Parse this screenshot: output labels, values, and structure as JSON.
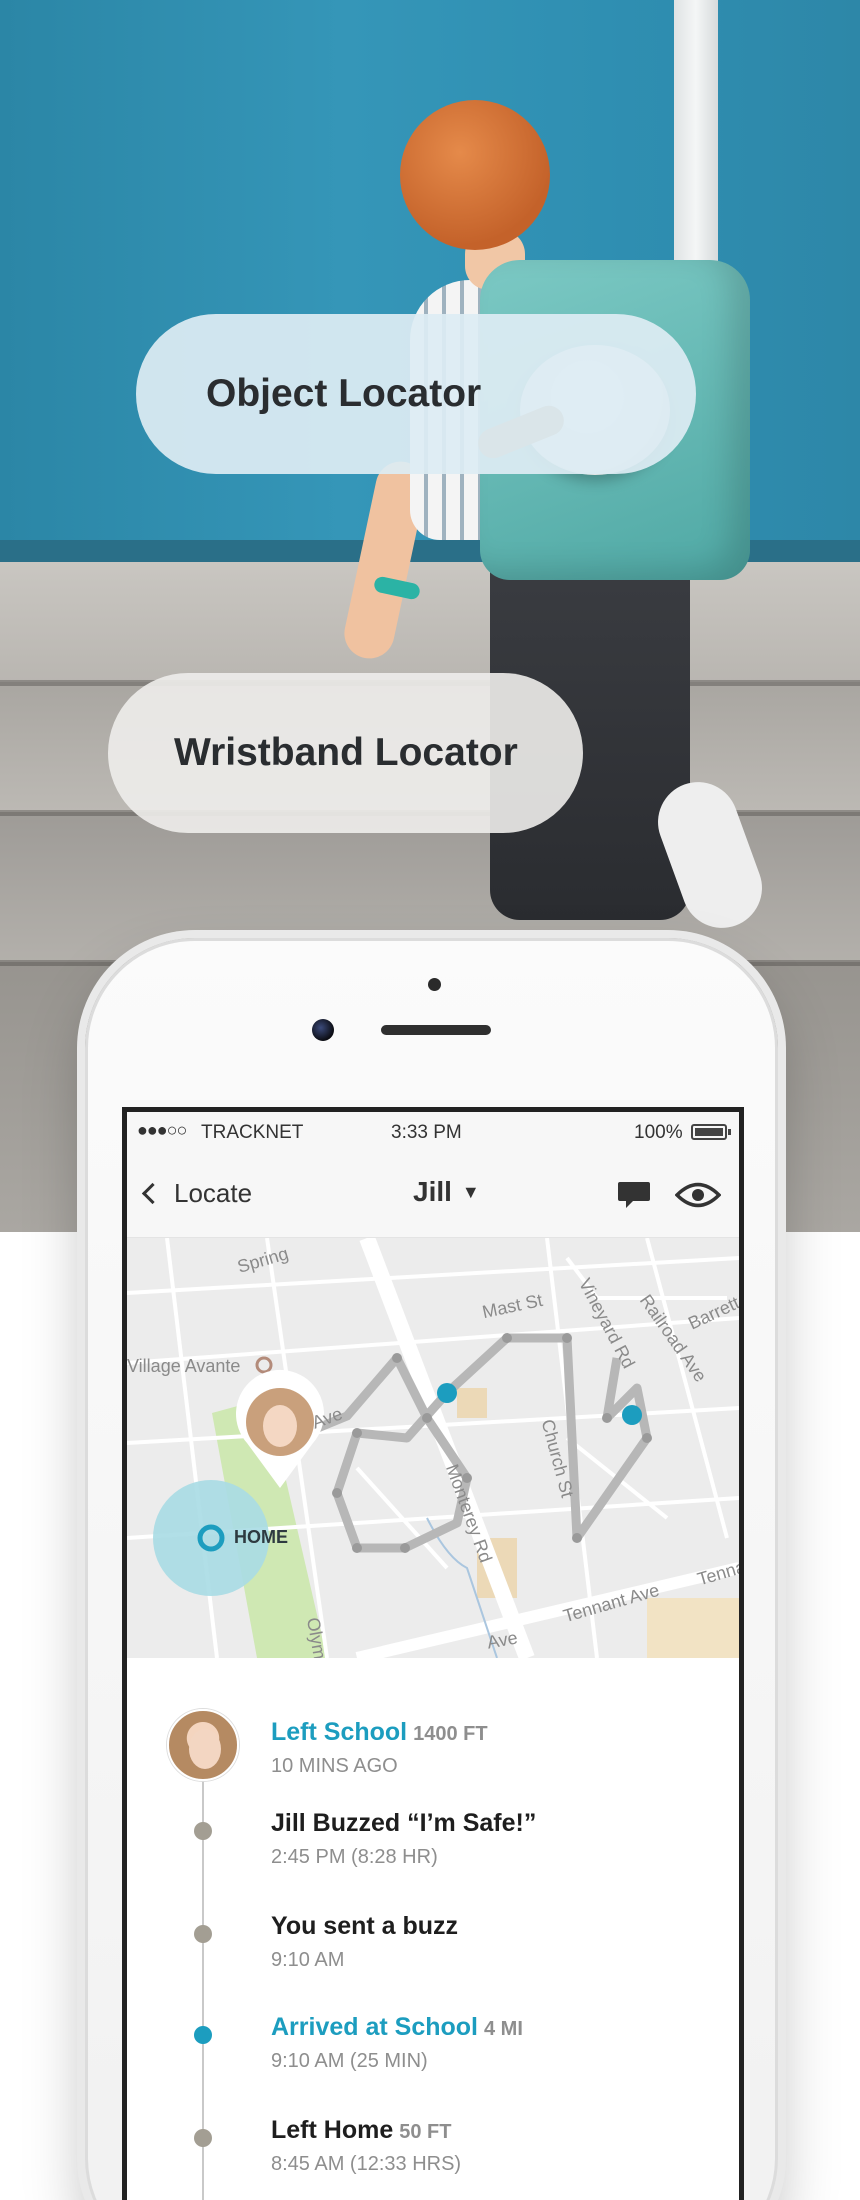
{
  "hero": {
    "object_label": "Object Locator",
    "wristband_label": "Wristband Locator"
  },
  "status_bar": {
    "carrier": "TRACKNET",
    "time": "3:33 PM",
    "battery": "100%"
  },
  "nav": {
    "back_label": "Locate",
    "title": "Jill",
    "chat_icon": "chat-bubble-icon",
    "eye_icon": "eye-icon"
  },
  "map": {
    "streets": [
      "Spring",
      "Mast St",
      "Vineyard Rd",
      "Railroad Ave",
      "Barrett",
      "Village Avante",
      "Ave",
      "Church St",
      "Monterey Rd",
      "Tennant Ave",
      "Tenna",
      "Ave",
      "Olym"
    ],
    "home_label": "HOME",
    "accent_color": "#1c9dbf",
    "home_zone_color": "#a8dbe4"
  },
  "timeline": {
    "entries": [
      {
        "title": "Left School",
        "meta": "1400 FT",
        "time": "10 MINS AGO",
        "accent": true
      },
      {
        "title": "Jill Buzzed “I’m Safe!”",
        "meta": "",
        "time": "2:45 PM (8:28 HR)",
        "accent": false
      },
      {
        "title": "You sent a buzz",
        "meta": "",
        "time": "9:10 AM",
        "accent": false
      },
      {
        "title": "Arrived at School",
        "meta": "4 MI",
        "time": "9:10 AM (25 MIN)",
        "accent": true
      },
      {
        "title": "Left Home",
        "meta": "50 FT",
        "time": "8:45 AM (12:33 HRS)",
        "accent": false
      }
    ]
  }
}
